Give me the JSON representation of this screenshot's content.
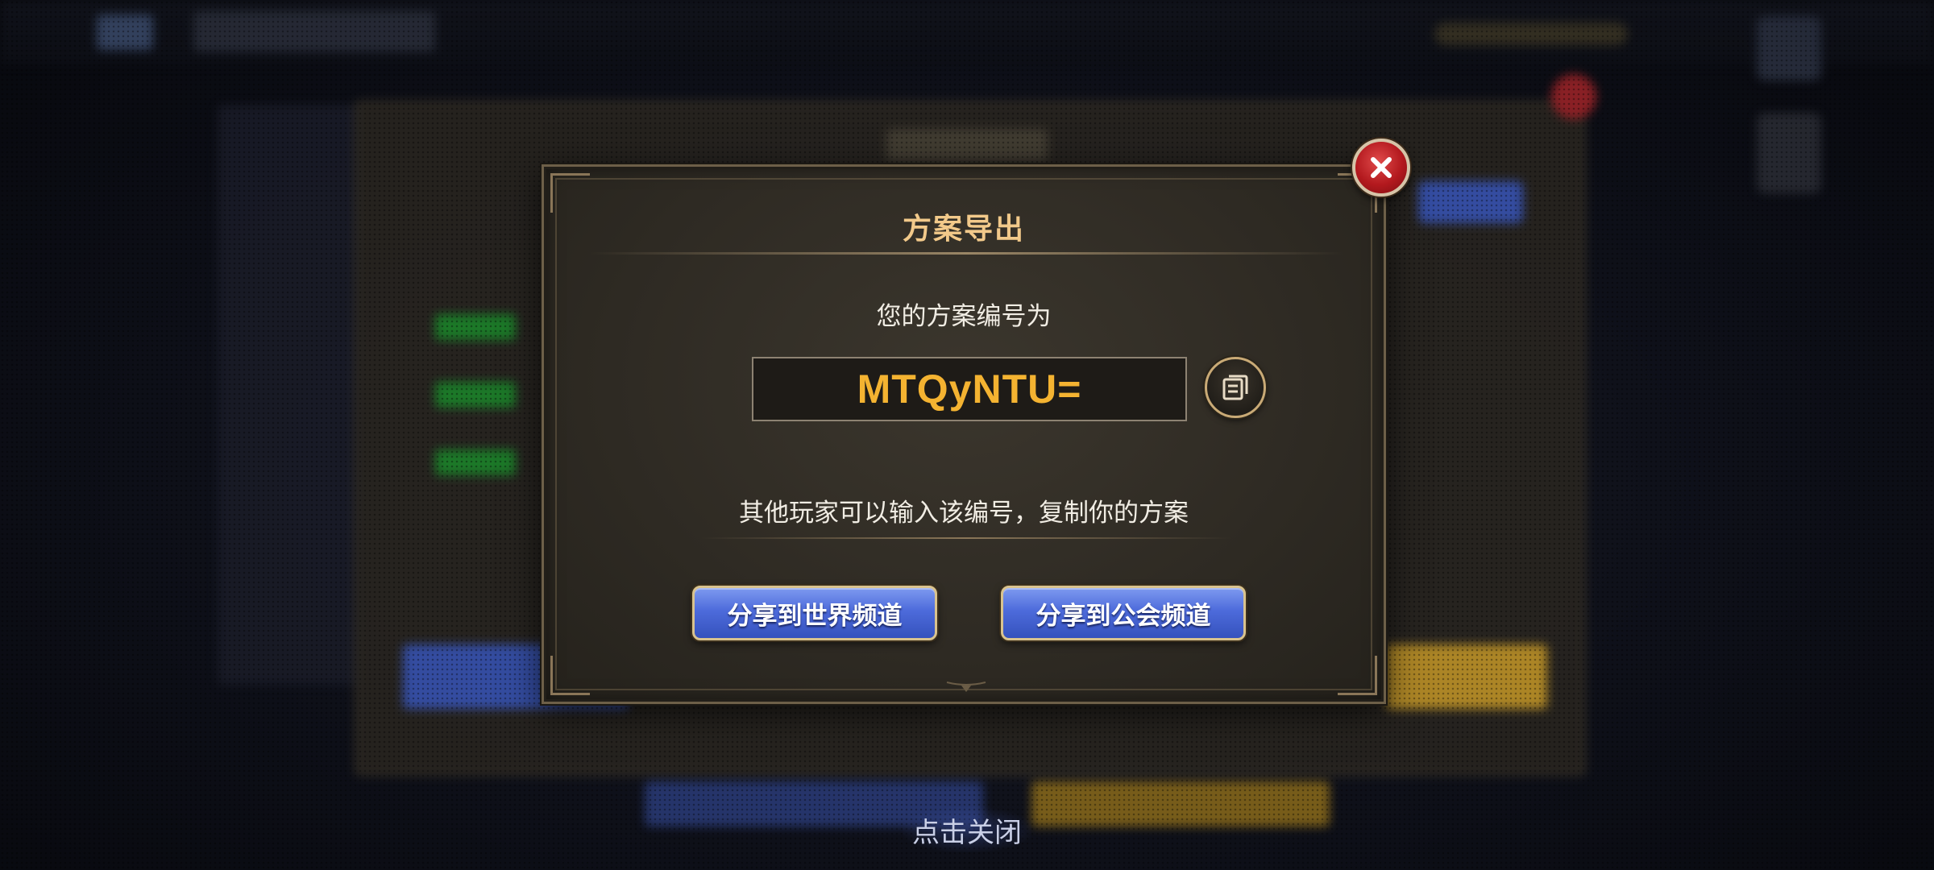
{
  "modal": {
    "title": "方案导出",
    "subtitle": "您的方案编号为",
    "code": "MTQyNTU=",
    "info": "其他玩家可以输入该编号，复制你的方案",
    "buttons": {
      "share_world": "分享到世界频道",
      "share_guild": "分享到公会频道"
    },
    "icons": {
      "copy": "copy-icon",
      "close": "close-icon"
    }
  },
  "footer": {
    "tap_to_close": "点击关闭"
  },
  "colors": {
    "title": "#f2c98a",
    "code": "#f4b331",
    "button_blue": "#4d6bdb",
    "close_red": "#b3191e"
  }
}
